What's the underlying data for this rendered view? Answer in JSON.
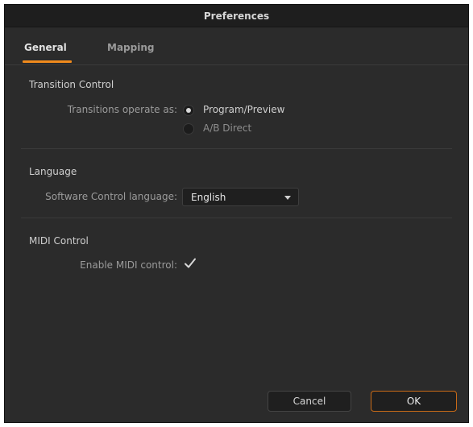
{
  "window": {
    "title": "Preferences"
  },
  "tabs": [
    {
      "label": "General",
      "active": true
    },
    {
      "label": "Mapping",
      "active": false
    }
  ],
  "transition_control": {
    "title": "Transition Control",
    "label": "Transitions operate as:",
    "options": [
      {
        "label": "Program/Preview",
        "selected": true
      },
      {
        "label": "A/B Direct",
        "selected": false
      }
    ]
  },
  "language": {
    "title": "Language",
    "label": "Software Control language:",
    "value": "English"
  },
  "midi": {
    "title": "MIDI Control",
    "label": "Enable MIDI control:",
    "checked": true
  },
  "buttons": {
    "cancel": "Cancel",
    "ok": "OK"
  },
  "colors": {
    "accent": "#f08a1c",
    "background": "#2b2b2b"
  }
}
